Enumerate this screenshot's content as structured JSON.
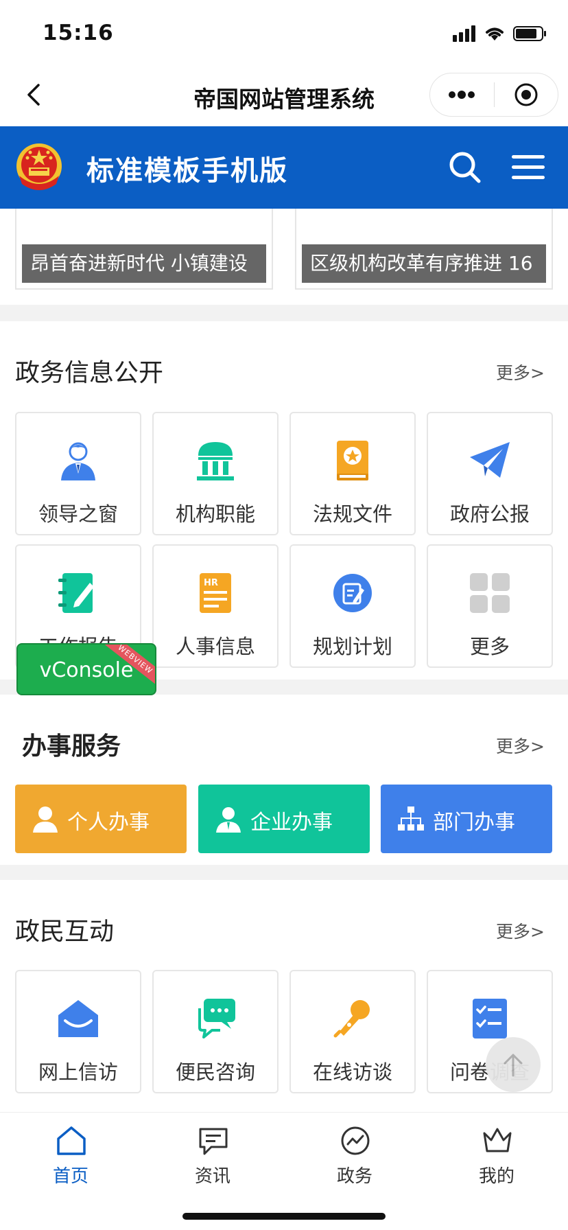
{
  "status_bar": {
    "time": "15:16"
  },
  "navbar": {
    "title": "帝国网站管理系统"
  },
  "header": {
    "site_title": "标准模板手机版"
  },
  "news_cards": [
    {
      "caption": "昂首奋进新时代 小镇建设"
    },
    {
      "caption": "区级机构改革有序推进 16"
    }
  ],
  "gov_info": {
    "title": "政务信息公开",
    "more": "更多>",
    "items": [
      {
        "label": "领导之窗",
        "icon": "leader-icon"
      },
      {
        "label": "机构职能",
        "icon": "institution-icon"
      },
      {
        "label": "法规文件",
        "icon": "regulation-book-icon"
      },
      {
        "label": "政府公报",
        "icon": "paper-plane-icon"
      },
      {
        "label": "工作报告",
        "icon": "report-notebook-icon"
      },
      {
        "label": "人事信息",
        "icon": "hr-document-icon"
      },
      {
        "label": "规划计划",
        "icon": "plan-edit-icon"
      },
      {
        "label": "更多",
        "icon": "grid-more-icon"
      }
    ]
  },
  "services": {
    "title": "办事服务",
    "more": "更多>",
    "items": [
      {
        "label": "个人办事",
        "icon": "person-icon",
        "color": "#f0a830"
      },
      {
        "label": "企业办事",
        "icon": "business-person-icon",
        "color": "#10c49a"
      },
      {
        "label": "部门办事",
        "icon": "org-chart-icon",
        "color": "#3f80ea"
      }
    ]
  },
  "interaction": {
    "title": "政民互动",
    "more": "更多>",
    "items": [
      {
        "label": "网上信访",
        "icon": "envelope-icon"
      },
      {
        "label": "便民咨询",
        "icon": "chat-bubbles-icon"
      },
      {
        "label": "在线访谈",
        "icon": "microphone-icon"
      },
      {
        "label": "问卷调查",
        "icon": "checklist-icon"
      }
    ]
  },
  "vconsole": {
    "label": "vConsole",
    "ribbon": "WEBVIEW"
  },
  "tabbar": [
    {
      "label": "首页",
      "icon": "home-icon",
      "active": true
    },
    {
      "label": "资讯",
      "icon": "message-icon",
      "active": false
    },
    {
      "label": "政务",
      "icon": "trend-icon",
      "active": false
    },
    {
      "label": "我的",
      "icon": "crown-icon",
      "active": false
    }
  ],
  "colors": {
    "primary": "#0b5ec4",
    "green": "#10c49a",
    "orange": "#f0a830",
    "blue": "#3f80ea"
  }
}
